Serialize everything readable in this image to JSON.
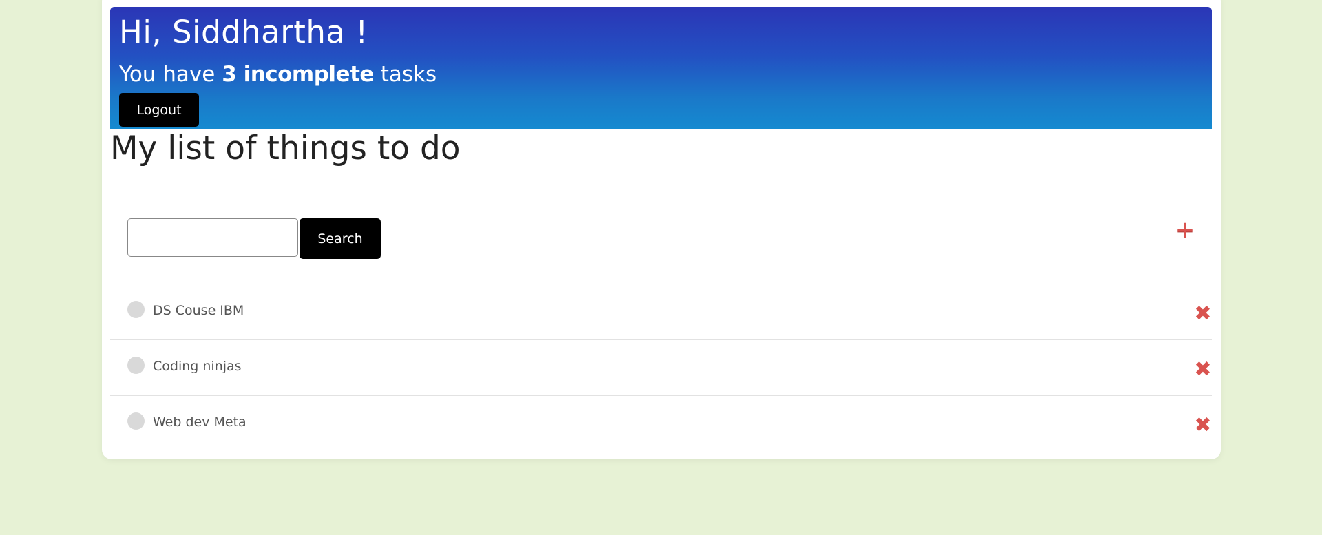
{
  "header": {
    "greeting": "Hi, Siddhartha !",
    "summary_prefix": "You have ",
    "summary_count": "3 incomplete",
    "summary_suffix": " tasks",
    "logout_label": "Logout"
  },
  "list": {
    "title": "My list of things to do"
  },
  "search": {
    "value": "",
    "placeholder": "",
    "button_label": "Search"
  },
  "add": {
    "icon": "plus-icon",
    "glyph": "+"
  },
  "tasks": [
    {
      "label": "DS Couse IBM",
      "completed": false,
      "delete_glyph": "✖"
    },
    {
      "label": "Coding ninjas",
      "completed": false,
      "delete_glyph": "✖"
    },
    {
      "label": "Web dev Meta",
      "completed": false,
      "delete_glyph": "✖"
    }
  ],
  "colors": {
    "page_background": "#e7f2d5",
    "header_gradient_top": "#2b36b6",
    "header_gradient_bottom": "#158ad0",
    "button_background": "#000000",
    "accent_red": "#d9534f",
    "checkbox_gray": "#d9d9d9"
  }
}
